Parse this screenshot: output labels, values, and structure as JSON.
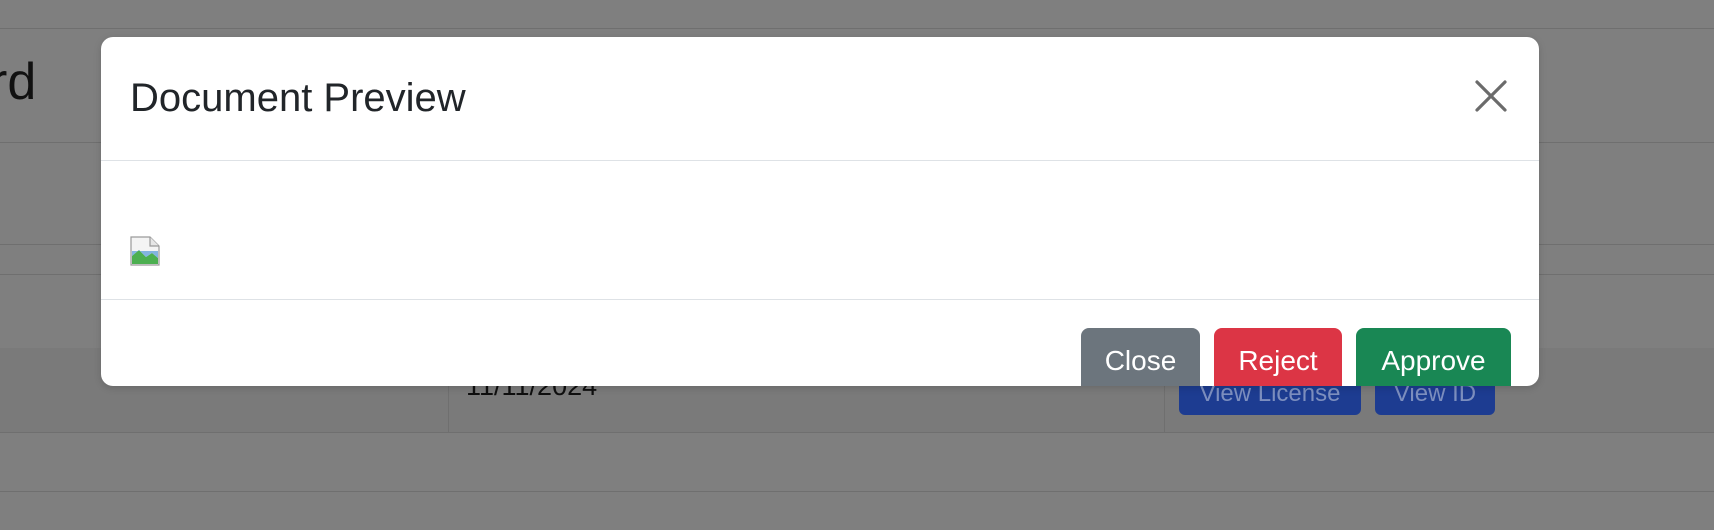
{
  "background": {
    "title_fragment": "rd",
    "date": "11/11/2024",
    "view_license_label": "View License",
    "view_id_label": "View ID"
  },
  "modal": {
    "title": "Document Preview",
    "close_icon": "close-x-icon",
    "body_image": "broken-image-icon",
    "buttons": {
      "close_label": "Close",
      "reject_label": "Reject",
      "approve_label": "Approve"
    }
  },
  "colors": {
    "backdrop": "#7f7f7f",
    "close_button": "#6c757d",
    "reject_button": "#dc3545",
    "approve_button": "#198754",
    "view_button": "#1d3c91"
  }
}
